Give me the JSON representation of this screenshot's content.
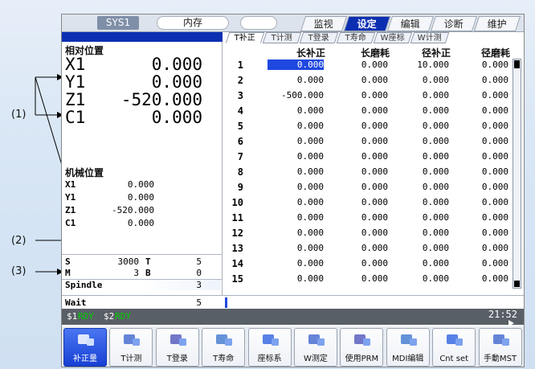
{
  "topbar": {
    "sys": "SYS1",
    "memory": "内存",
    "modes": [
      "监视",
      "设定",
      "编辑",
      "诊断",
      "维护"
    ],
    "active_mode": "设定"
  },
  "callouts": {
    "c1": "(1)",
    "c2": "(2)",
    "c3": "(3)"
  },
  "relative": {
    "title": "相对位置",
    "axes": [
      {
        "name": "X1",
        "value": "0.000"
      },
      {
        "name": "Y1",
        "value": "0.000"
      },
      {
        "name": "Z1",
        "value": "-520.000"
      },
      {
        "name": "C1",
        "value": "0.000"
      }
    ]
  },
  "machine": {
    "title": "机械位置",
    "axes": [
      {
        "name": "X1",
        "value": "0.000"
      },
      {
        "name": "Y1",
        "value": "0.000"
      },
      {
        "name": "Z1",
        "value": "-520.000"
      },
      {
        "name": "C1",
        "value": "0.000"
      }
    ]
  },
  "modal": {
    "s_label": "S",
    "s_value": "3000",
    "t_label": "T",
    "t_value": "5",
    "m_label": "M",
    "m_value": "3",
    "b_label": "B",
    "b_value": "0"
  },
  "spindle": {
    "label": "Spindle",
    "value": "3"
  },
  "wait": {
    "label": "Wait",
    "value": "5"
  },
  "tool_tabs": [
    "T补正",
    "T计测",
    "T登录",
    "T寿命",
    "W座标",
    "W计测"
  ],
  "active_tool_tab": "T补正",
  "table": {
    "headers": [
      "长补正",
      "长磨耗",
      "径补正",
      "径磨耗"
    ],
    "rows": [
      {
        "no": "1",
        "cells": [
          "0.000",
          "0.000",
          "10.000",
          "0.000"
        ]
      },
      {
        "no": "2",
        "cells": [
          "0.000",
          "0.000",
          "0.000",
          "0.000"
        ]
      },
      {
        "no": "3",
        "cells": [
          "-500.000",
          "0.000",
          "0.000",
          "0.000"
        ]
      },
      {
        "no": "4",
        "cells": [
          "0.000",
          "0.000",
          "0.000",
          "0.000"
        ]
      },
      {
        "no": "5",
        "cells": [
          "0.000",
          "0.000",
          "0.000",
          "0.000"
        ]
      },
      {
        "no": "6",
        "cells": [
          "0.000",
          "0.000",
          "0.000",
          "0.000"
        ]
      },
      {
        "no": "7",
        "cells": [
          "0.000",
          "0.000",
          "0.000",
          "0.000"
        ]
      },
      {
        "no": "8",
        "cells": [
          "0.000",
          "0.000",
          "0.000",
          "0.000"
        ]
      },
      {
        "no": "9",
        "cells": [
          "0.000",
          "0.000",
          "0.000",
          "0.000"
        ]
      },
      {
        "no": "10",
        "cells": [
          "0.000",
          "0.000",
          "0.000",
          "0.000"
        ]
      },
      {
        "no": "11",
        "cells": [
          "0.000",
          "0.000",
          "0.000",
          "0.000"
        ]
      },
      {
        "no": "12",
        "cells": [
          "0.000",
          "0.000",
          "0.000",
          "0.000"
        ]
      },
      {
        "no": "13",
        "cells": [
          "0.000",
          "0.000",
          "0.000",
          "0.000"
        ]
      },
      {
        "no": "14",
        "cells": [
          "0.000",
          "0.000",
          "0.000",
          "0.000"
        ]
      },
      {
        "no": "15",
        "cells": [
          "0.000",
          "0.000",
          "0.000",
          "0.000"
        ]
      }
    ]
  },
  "status": {
    "s1": "$1",
    "s1_state": "RDY",
    "s2": "$2",
    "s2_state": "RDY",
    "clock": "21:52"
  },
  "softkeys": [
    {
      "label": "补正量",
      "icon": "tool-offset-icon"
    },
    {
      "label": "T计测",
      "icon": "tool-measure-icon"
    },
    {
      "label": "T登录",
      "icon": "tool-register-icon"
    },
    {
      "label": "T寿命",
      "icon": "tool-life-icon"
    },
    {
      "label": "座标系",
      "icon": "coordinate-system-icon"
    },
    {
      "label": "W测定",
      "icon": "workpiece-measure-icon"
    },
    {
      "label": "使用PRM",
      "icon": "parameter-icon"
    },
    {
      "label": "MDI编辑",
      "icon": "mdi-edit-icon"
    },
    {
      "label": "Cnt set",
      "icon": "counter-set-icon"
    },
    {
      "label": "手動MST",
      "icon": "manual-mst-icon"
    }
  ],
  "colors": {
    "accent": "#0c2fb2",
    "selection": "#1f48e0",
    "status_bar": "#595f66",
    "ready": "#00d000"
  }
}
